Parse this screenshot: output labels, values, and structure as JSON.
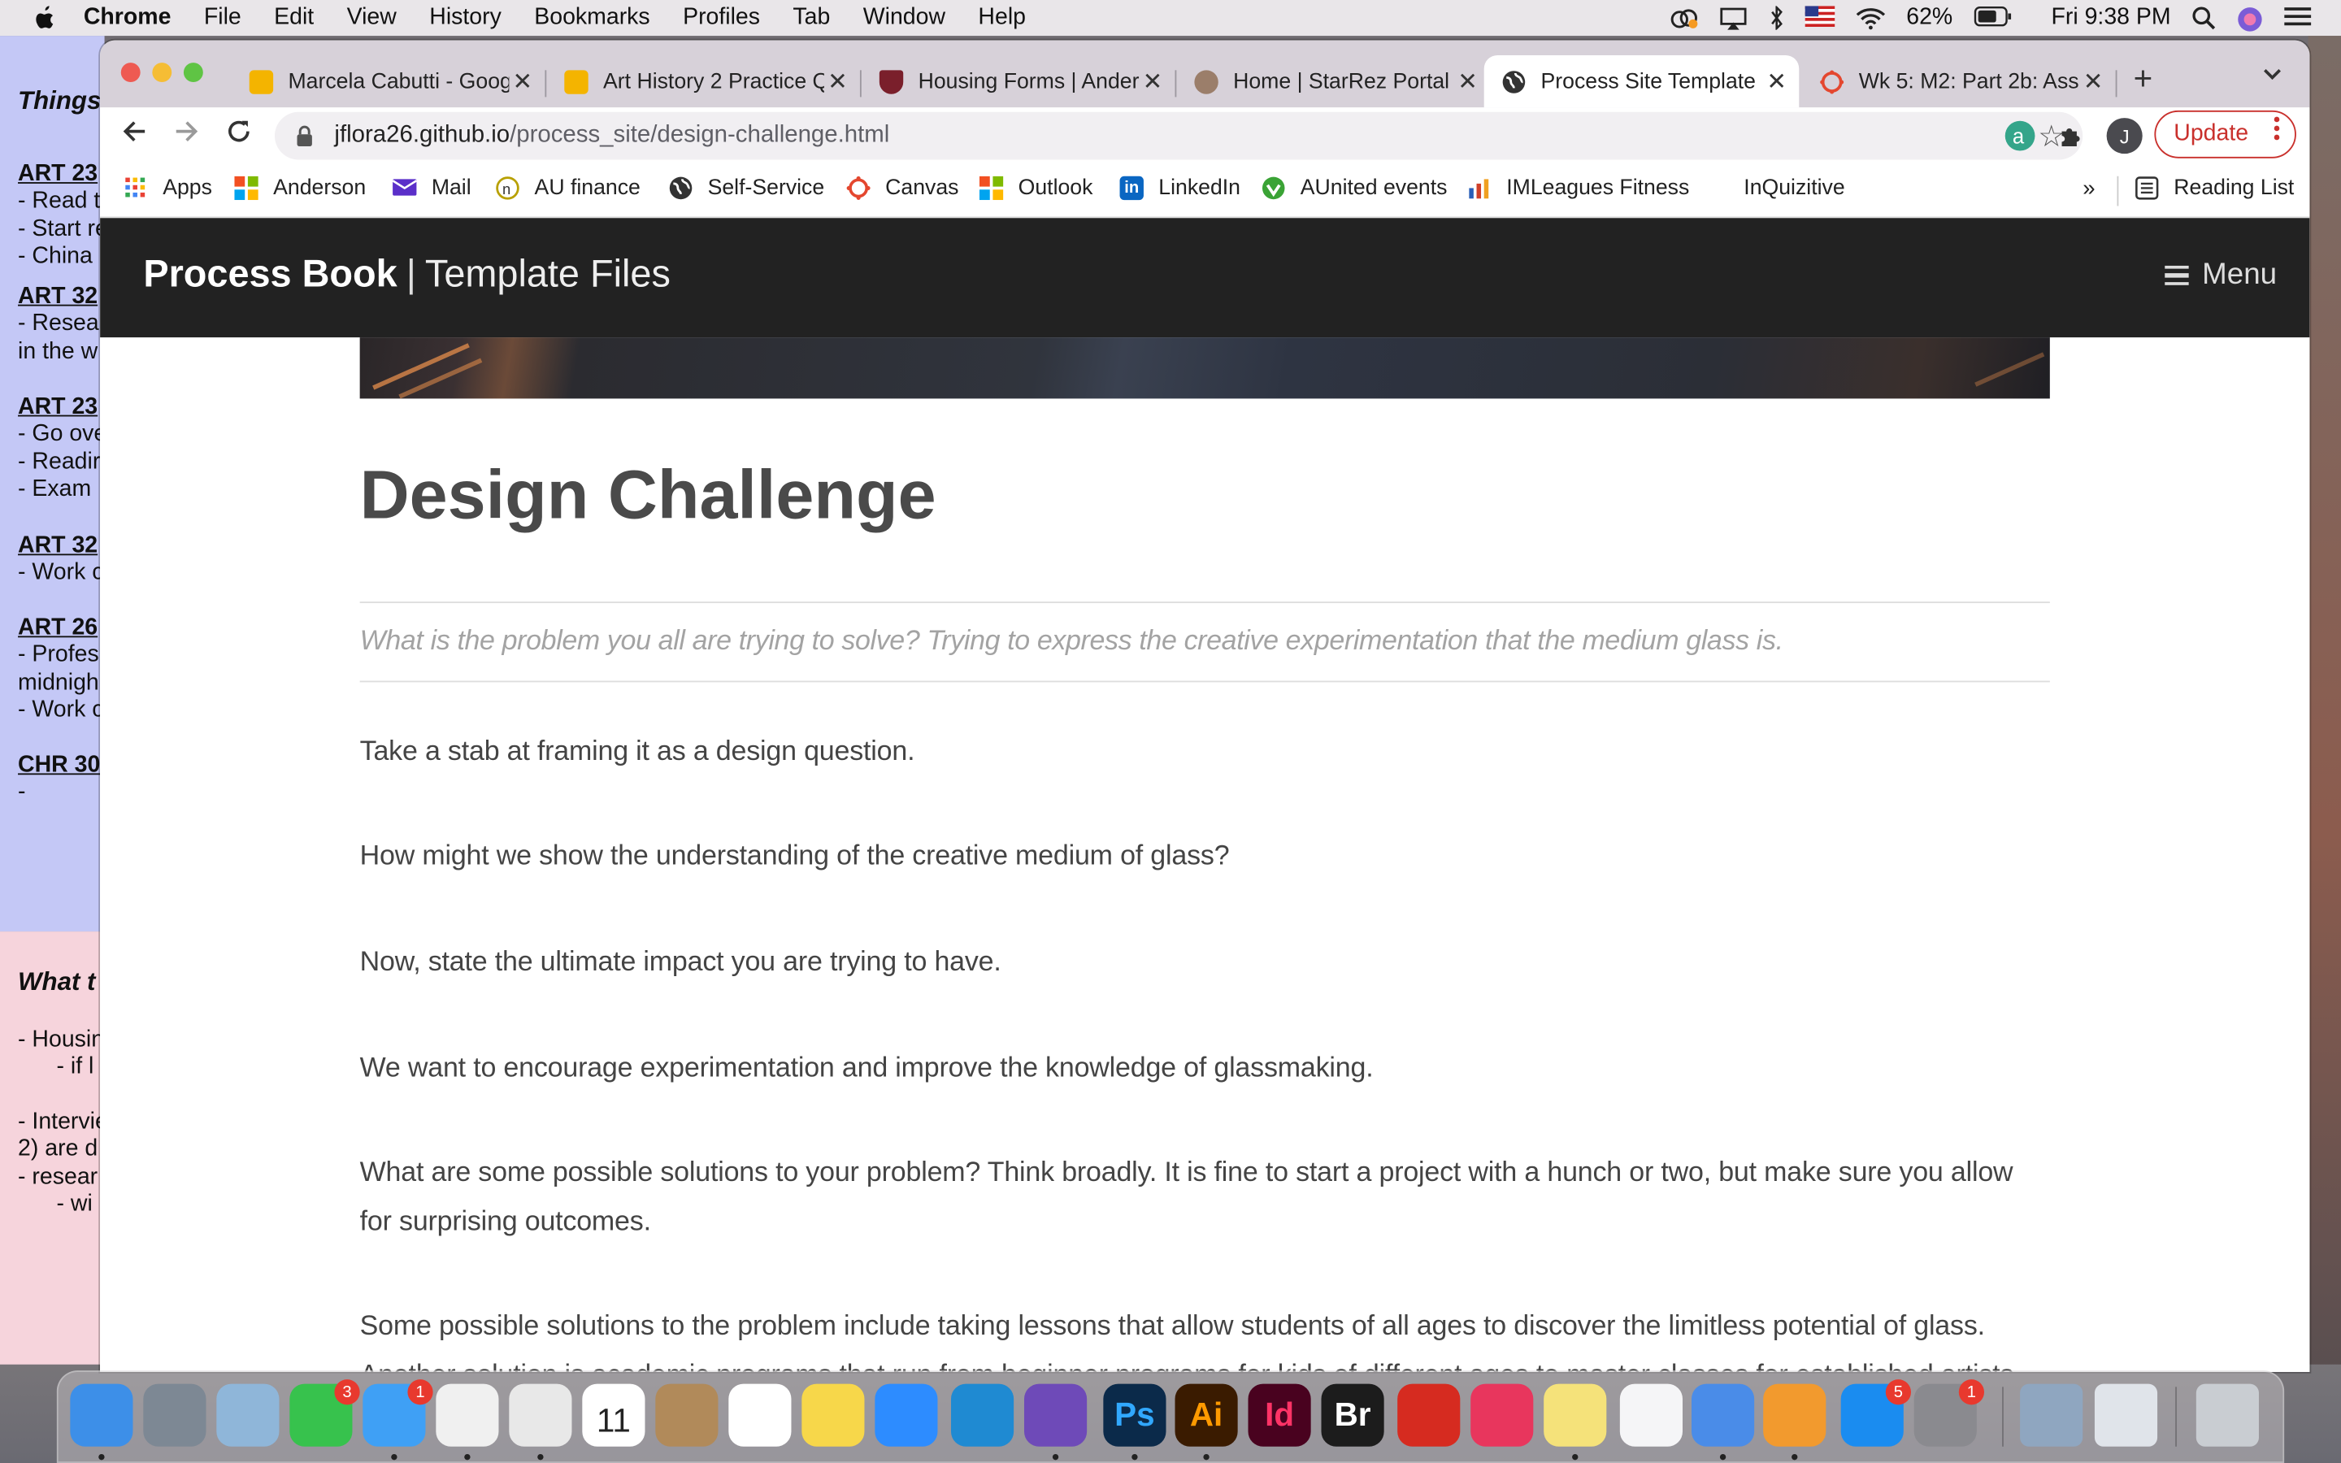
{
  "menubar": {
    "app": "Chrome",
    "items": [
      "File",
      "Edit",
      "View",
      "History",
      "Bookmarks",
      "Profiles",
      "Tab",
      "Window",
      "Help"
    ],
    "battery": "62%",
    "clock": "Fri 9:38 PM"
  },
  "background_notes": {
    "blue": [
      {
        "text": "Things",
        "style": "i"
      },
      {
        "text": "ART 23",
        "style": "h"
      },
      {
        "text": "- Read t",
        "style": ""
      },
      {
        "text": "- Start re",
        "style": ""
      },
      {
        "text": "- China",
        "style": ""
      },
      {
        "text": "ART 32",
        "style": "h"
      },
      {
        "text": "-  Resea",
        "style": ""
      },
      {
        "text": "in the w",
        "style": ""
      },
      {
        "text": "ART 23",
        "style": "h"
      },
      {
        "text": "- Go ove",
        "style": ""
      },
      {
        "text": "- Readir",
        "style": ""
      },
      {
        "text": "- Exam",
        "style": ""
      },
      {
        "text": "ART 32",
        "style": "h"
      },
      {
        "text": "- Work c",
        "style": ""
      },
      {
        "text": "ART 26",
        "style": "h"
      },
      {
        "text": "- Profes",
        "style": ""
      },
      {
        "text": "midnigh",
        "style": ""
      },
      {
        "text": "- Work c",
        "style": ""
      },
      {
        "text": "CHR 30",
        "style": "h"
      },
      {
        "text": "-",
        "style": ""
      }
    ],
    "pink": [
      {
        "text": "What t",
        "style": "i"
      },
      {
        "text": "- Housin",
        "style": ""
      },
      {
        "text": "      - if l",
        "style": ""
      },
      {
        "text": "- Intervie",
        "style": ""
      },
      {
        "text": "2) are d",
        "style": ""
      },
      {
        "text": "- resear",
        "style": ""
      },
      {
        "text": "      - wi",
        "style": ""
      }
    ]
  },
  "tabs": [
    {
      "title": "Marcela Cabutti - Goog",
      "active": false,
      "favicon_color": "#f4b400"
    },
    {
      "title": "Art History 2 Practice Q",
      "active": false,
      "favicon_color": "#f4b400"
    },
    {
      "title": "Housing Forms | Ander",
      "active": false,
      "favicon_color": "#7a1f2b"
    },
    {
      "title": "Home | StarRez Portal",
      "active": false,
      "favicon_color": "#9b7e6a"
    },
    {
      "title": "Process Site Template",
      "active": true,
      "favicon_color": "#333333"
    },
    {
      "title": "Wk 5: M2: Part 2b: Ass",
      "active": false,
      "favicon_color": "#e4472f"
    }
  ],
  "toolbar": {
    "url_host": "jflora26.github.io",
    "url_path": "/process_site/design-challenge.html",
    "profile_initial": "J",
    "update_label": "Update"
  },
  "bookmarks": [
    {
      "label": "Apps",
      "icon": "apps-grid-icon",
      "color": "#e94235"
    },
    {
      "label": "Anderson",
      "icon": "microsoft-icon",
      "color": "#f25022"
    },
    {
      "label": "Mail",
      "icon": "mail-icon",
      "color": "#5b2fc9"
    },
    {
      "label": "AU finance",
      "icon": "au-finance-icon",
      "color": "#b8a000"
    },
    {
      "label": "Self-Service",
      "icon": "globe-icon",
      "color": "#333333"
    },
    {
      "label": "Canvas",
      "icon": "canvas-icon",
      "color": "#e4472f"
    },
    {
      "label": "Outlook",
      "icon": "microsoft-icon",
      "color": "#f25022"
    },
    {
      "label": "LinkedIn",
      "icon": "linkedin-icon",
      "color": "#0a66c2"
    },
    {
      "label": "AUnited events",
      "icon": "aunited-icon",
      "color": "#3aa335"
    },
    {
      "label": "IMLeagues Fitness",
      "icon": "imleagues-icon",
      "color": "#d0402a"
    },
    {
      "label": "InQuizitive",
      "icon": "",
      "color": ""
    }
  ],
  "bookmarks_overflow": "»",
  "reading_list": "Reading List",
  "site": {
    "brand_bold": "Process Book",
    "brand_sep": "|",
    "brand_sub": "Template Files",
    "menu_label": "Menu",
    "title": "Design Challenge",
    "lead": "What is the problem you all are trying to solve? Trying to express the creative experimentation that the medium glass is.",
    "paragraphs": [
      "Take a stab at framing it as a design question.",
      "How might we show the understanding of the creative medium of glass?",
      "Now, state the ultimate impact you are trying to have.",
      "We want to encourage experimentation and improve the knowledge of glassmaking.",
      "What are some possible solutions to your problem? Think broadly. It is fine to start a project with a hunch or two, but make sure you allow for surprising outcomes.",
      "Some possible solutions to the problem include taking lessons that allow students of all ages to discover the limitless potential of glass. Another solution is academic programs that run from beginner programs for kids of different ages to master classes for established artists."
    ]
  },
  "dock": [
    {
      "name": "finder-icon",
      "label": "",
      "color": "#3d8fe8"
    },
    {
      "name": "launchpad-icon",
      "label": "",
      "color": "#7d8894"
    },
    {
      "name": "preview-icon",
      "label": "",
      "color": "#8fb6d9"
    },
    {
      "name": "facetime-icon",
      "label": "",
      "color": "#37c24d",
      "badge": "3"
    },
    {
      "name": "messages-icon",
      "label": "",
      "color": "#3fa0f5",
      "badge": "1"
    },
    {
      "name": "photos-icon",
      "label": "",
      "color": "#f0f0f0"
    },
    {
      "name": "chrome-icon",
      "label": "",
      "color": "#e8e8e8"
    },
    {
      "name": "calendar-icon",
      "label": "11",
      "color": "#ffffff"
    },
    {
      "name": "calculator-icon",
      "label": "",
      "color": "#b18a5a"
    },
    {
      "name": "reminders-icon",
      "label": "",
      "color": "#ffffff"
    },
    {
      "name": "notes-icon",
      "label": "",
      "color": "#f7d74a"
    },
    {
      "name": "zoom-icon",
      "label": "",
      "color": "#2d8cff"
    },
    {
      "name": "vscode-icon",
      "label": "",
      "color": "#1f8ad2"
    },
    {
      "name": "github-desktop-icon",
      "label": "",
      "color": "#6e4ab8"
    },
    {
      "name": "photoshop-icon",
      "label": "Ps",
      "color": "#0b2a4a"
    },
    {
      "name": "illustrator-icon",
      "label": "Ai",
      "color": "#3a1b00"
    },
    {
      "name": "indesign-icon",
      "label": "Id",
      "color": "#49021f"
    },
    {
      "name": "bridge-icon",
      "label": "Br",
      "color": "#1c1c1c"
    },
    {
      "name": "acrobat-icon",
      "label": "",
      "color": "#d62b20"
    },
    {
      "name": "creative-cloud-icon",
      "label": "",
      "color": "#e8365d"
    },
    {
      "name": "stickies-icon",
      "label": "",
      "color": "#f5e27a"
    },
    {
      "name": "music-icon",
      "label": "",
      "color": "#f5f5f7"
    },
    {
      "name": "keynote-icon",
      "label": "",
      "color": "#4a8ce8"
    },
    {
      "name": "pages-icon",
      "label": "",
      "color": "#f29a2e"
    },
    {
      "name": "app-store-icon",
      "label": "",
      "color": "#1a8cf0",
      "badge": "5"
    },
    {
      "name": "system-preferences-icon",
      "label": "",
      "color": "#8a8a8f",
      "badge": "1"
    },
    {
      "name": "screenshot-folder-icon",
      "label": "",
      "color": "#8fa6c0"
    },
    {
      "name": "downloads-folder-icon",
      "label": "",
      "color": "#e0e4ea"
    },
    {
      "name": "trash-icon",
      "label": "",
      "color": "#c9cdd2"
    }
  ]
}
